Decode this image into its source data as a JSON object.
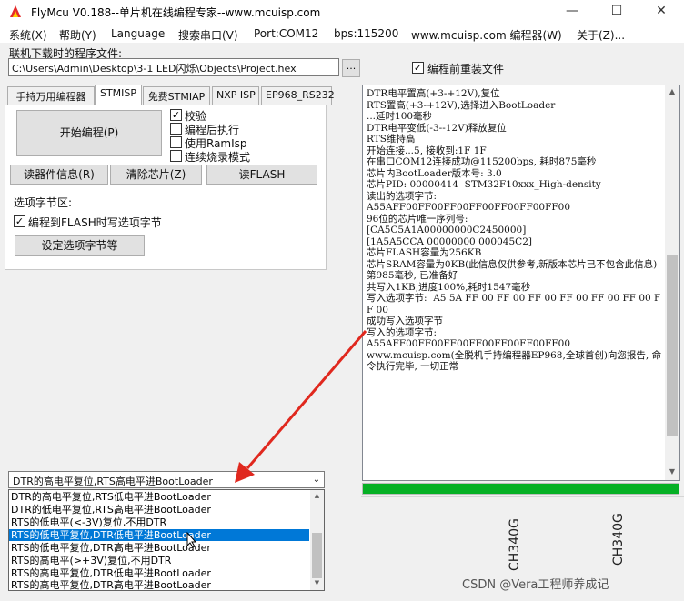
{
  "window": {
    "title": "FlyMcu V0.188--单片机在线编程专家--www.mcuisp.com",
    "minimize": "—",
    "maximize": "☐",
    "close": "✕"
  },
  "menu": [
    "系统(X)",
    "帮助(Y)",
    "Language",
    "搜索串口(V)",
    "Port:COM12",
    "bps:115200",
    "www.mcuisp.com 编程器(W)",
    "关于(Z)..."
  ],
  "file": {
    "label": "联机下载时的程序文件:",
    "path": "C:\\Users\\Admin\\Desktop\\3-1 LED闪烁\\Objects\\Project.hex",
    "browse": "...",
    "reload_label": "编程前重装文件",
    "reload_checked": "✓"
  },
  "tabs": [
    "手持万用编程器",
    "STMISP",
    "免费STMIAP",
    "NXP ISP",
    "EP968_RS232"
  ],
  "panel": {
    "start_button": "开始编程(P)",
    "options": [
      {
        "label": "校验",
        "checked": "✓"
      },
      {
        "label": "编程后执行",
        "checked": ""
      },
      {
        "label": "使用RamIsp",
        "checked": ""
      },
      {
        "label": "连续烧录模式",
        "checked": ""
      }
    ],
    "read_button": "读器件信息(R)",
    "erase_button": "清除芯片(Z)",
    "readflash_button": "读FLASH"
  },
  "option_bytes": {
    "group_label": "选项字节区:",
    "checkbox_label": "编程到FLASH时写选项字节",
    "checkbox_checked": "✓",
    "set_button": "设定选项字节等"
  },
  "log": "DTR电平置高(+3-+12V),复位\nRTS置高(+3-+12V),选择进入BootLoader\n...延时100毫秒\nDTR电平变低(-3--12V)释放复位\nRTS维持高\n开始连接...5, 接收到:1F 1F\n在串口COM12连接成功@115200bps, 耗时875毫秒\n芯片内BootLoader版本号: 3.0\n芯片PID: 00000414  STM32F10xxx_High-density\n读出的选项字节:\nA55AFF00FF00FF00FF00FF00FF00FF00\n96位的芯片唯一序列号:\n[CA5C5A1A00000000C2450000]\n[1A5A5CCA 00000000 000045C2]\n芯片FLASH容量为256KB\n芯片SRAM容量为0KB(此信息仅供参考,新版本芯片已不包含此信息)\n第985毫秒, 已准备好\n共写入1KB,进度100%,耗时1547毫秒\n写入选项字节:  A5 5A FF 00 FF 00 FF 00 FF 00 FF 00 FF 00 FF 00\n成功写入选项字节\n写入的选项字节:\nA55AFF00FF00FF00FF00FF00FF00FF00\nwww.mcuisp.com(全脱机手持编程器EP968,全球首创)向您报告, 命令执行完毕, 一切正常",
  "progress_percent": 100,
  "combo": {
    "value": "DTR的高电平复位,RTS高电平进BootLoader",
    "arrow": "⌄",
    "options": [
      "DTR的高电平复位,RTS低电平进BootLoader",
      "DTR的低电平复位,RTS高电平进BootLoader",
      "RTS的低电平(<-3V)复位,不用DTR",
      "RTS的低电平复位,DTR低电平进BootLoader",
      "RTS的低电平复位,DTR高电平进BootLoader",
      "RTS的高电平(>+3V)复位,不用DTR",
      "RTS的高电平复位,DTR低电平进BootLoader",
      "RTS的高电平复位,DTR高电平进BootLoader"
    ],
    "selected_index": 3
  },
  "background_labels": [
    "CH340G",
    "CH340G"
  ],
  "watermark": "CSDN @Vera工程师养成记",
  "colors": {
    "progress": "#06b025",
    "selection": "#0078d7",
    "arrow": "#e0281e"
  }
}
